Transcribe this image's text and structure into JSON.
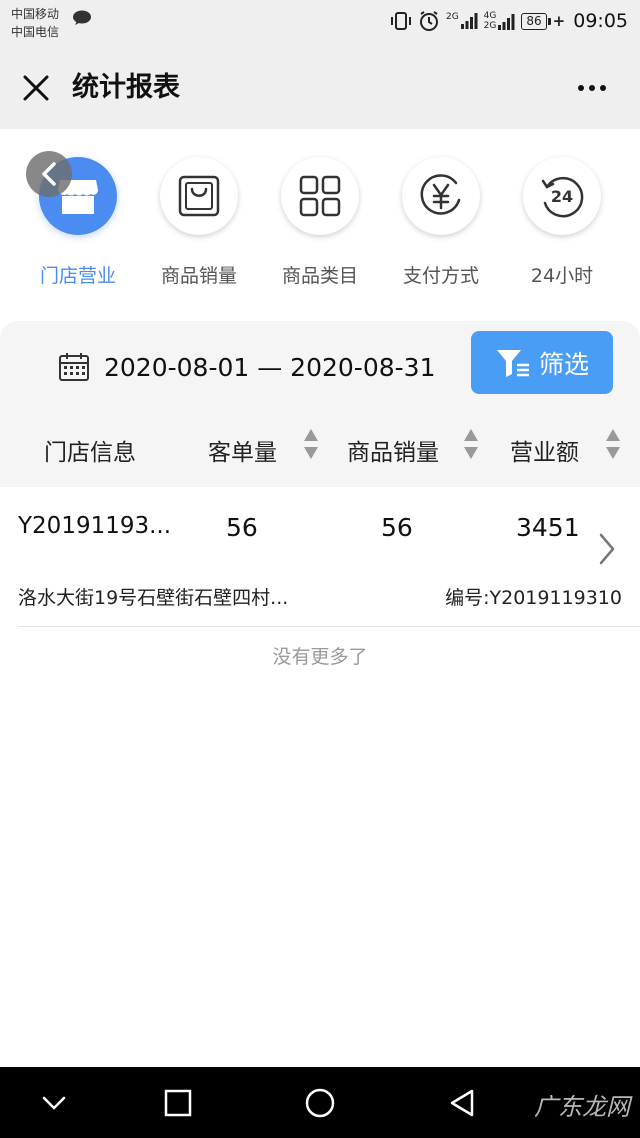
{
  "status_bar": {
    "carrier1": "中国移动",
    "carrier2": "中国电信",
    "network1": "2G",
    "network2": "4G",
    "network3": "2G",
    "battery": "86",
    "time": "09:05"
  },
  "header": {
    "title": "统计报表",
    "close_icon": "close-icon",
    "more_icon": "more-icon"
  },
  "tabs": [
    {
      "label": "门店营业",
      "icon": "store-icon",
      "active": true
    },
    {
      "label": "商品销量",
      "icon": "shopping-bag-icon",
      "active": false
    },
    {
      "label": "商品类目",
      "icon": "grid-icon",
      "active": false
    },
    {
      "label": "支付方式",
      "icon": "yuan-icon",
      "active": false
    },
    {
      "label": "24小时",
      "icon": "clock-24-icon",
      "active": false
    }
  ],
  "filter": {
    "date_range": "2020-08-01 — 2020-08-31",
    "button_label": "筛选"
  },
  "table": {
    "columns": [
      "门店信息",
      "客单量",
      "商品销量",
      "营业额"
    ],
    "rows": [
      {
        "store_id": "Y20191193...",
        "orders": "56",
        "sales": "56",
        "revenue": "3451",
        "address": "洛水大街19号石壁街石壁四村...",
        "code": "编号:Y2019119310"
      }
    ],
    "footer": "没有更多了"
  },
  "watermark": "广东龙网",
  "colors": {
    "accent": "#4a8cf0",
    "filter_button": "#4a9df5",
    "background": "#efefef"
  }
}
